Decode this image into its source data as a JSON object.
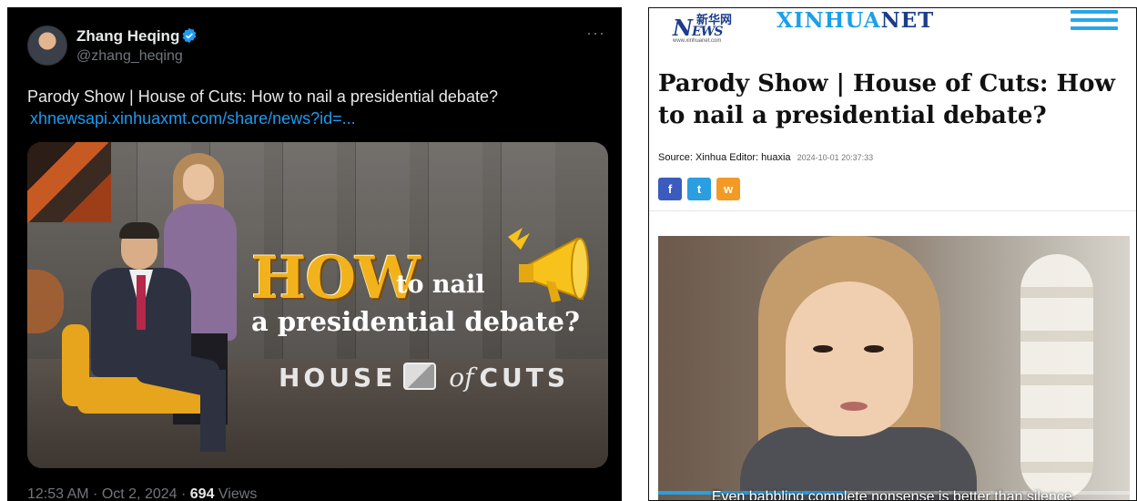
{
  "tweet": {
    "author_name": "Zhang Heqing",
    "handle": "@zhang_heqing",
    "more_label": "···",
    "text": "Parody Show | House of Cuts: How to nail a presidential debate?",
    "link": "xhnewsapi.xinhuaxmt.com/share/news?id=...",
    "time": "12:53 AM · Oct 2, 2024 · ",
    "views_count": "694",
    "views_label": "Views",
    "image": {
      "how": "HOW",
      "to_nail": "to nail",
      "line2": "a presidential debate?",
      "house": "HOUSE",
      "of": "of",
      "cuts": "CUTS"
    }
  },
  "article": {
    "logo_cn": "新华网",
    "logo_news": "N",
    "logo_news_rest": "EWS",
    "logo_url": "www.xinhuanet.com",
    "brand_part1": "XINHUA",
    "brand_part2": "NET",
    "headline": "Parody Show | House of Cuts: How to nail a presidential debate?",
    "source": "Source: Xinhua   Editor: huaxia",
    "date": "2024-10-01 20:37:33",
    "share_facebook": "f",
    "share_twitter": "t",
    "share_weibo": "w",
    "subtitle": "Even babbling complete nonsense is better than silence.",
    "video_progress": 0.4
  },
  "colors": {
    "twitter_link": "#1d9bf0",
    "xinhua_blue": "#1b3d8a",
    "xinhua_light": "#1aa0e8"
  }
}
